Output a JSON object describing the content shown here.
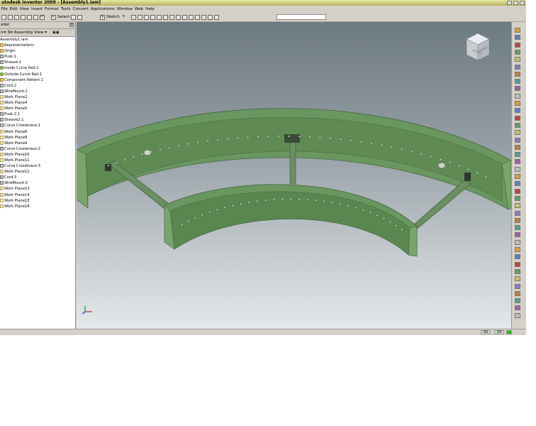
{
  "window": {
    "title": "utodesk Inventor 2009 - [Assembly1.iam]"
  },
  "menu": {
    "items": [
      "File",
      "Edit",
      "View",
      "Insert",
      "Format",
      "Tools",
      "Convert",
      "Applications",
      "Window",
      "Web",
      "Help"
    ]
  },
  "toolbar": {
    "select_label": "Select",
    "sketch_label": "Sketch"
  },
  "browser": {
    "header": "odel",
    "view_label": "Assembly View",
    "items": [
      {
        "label": "Assembly1.iam",
        "kind": "root"
      },
      {
        "label": "Representations",
        "kind": "folder"
      },
      {
        "label": "Origin",
        "kind": "folder"
      },
      {
        "label": "Pusk:1",
        "kind": "part"
      },
      {
        "label": "Sheave:1",
        "kind": "part"
      },
      {
        "label": "Inside Curve Rail:1",
        "kind": "cc"
      },
      {
        "label": "Outside Curve Rail:1",
        "kind": "cc"
      },
      {
        "label": "Component Pattern:1",
        "kind": "folder"
      },
      {
        "label": "Cord:2",
        "kind": "part"
      },
      {
        "label": "WireMount:2",
        "kind": "part"
      },
      {
        "label": "Work Plane2",
        "kind": "plane"
      },
      {
        "label": "Work Plane4",
        "kind": "plane"
      },
      {
        "label": "Work Plane5",
        "kind": "plane"
      },
      {
        "label": "Pusk:2:1",
        "kind": "part"
      },
      {
        "label": "Sheave2:1",
        "kind": "part"
      },
      {
        "label": "Curve Crossbrace:1",
        "kind": "part"
      },
      {
        "label": "Work Plane6",
        "kind": "plane"
      },
      {
        "label": "Work Plane8",
        "kind": "plane"
      },
      {
        "label": "Work Plane9",
        "kind": "plane"
      },
      {
        "label": "Curve Crossbrace:2",
        "kind": "part"
      },
      {
        "label": "Work Plane10",
        "kind": "plane"
      },
      {
        "label": "Work Plane11",
        "kind": "plane"
      },
      {
        "label": "Curve Crossbrace:3",
        "kind": "part"
      },
      {
        "label": "Work Plane12",
        "kind": "plane"
      },
      {
        "label": "Cord:3",
        "kind": "part"
      },
      {
        "label": "WireMount:3",
        "kind": "part"
      },
      {
        "label": "Work Plane13",
        "kind": "plane"
      },
      {
        "label": "Work Plane14",
        "kind": "plane"
      },
      {
        "label": "Work Plane15",
        "kind": "plane"
      },
      {
        "label": "Work Plane16",
        "kind": "plane"
      }
    ]
  },
  "viewcube": {
    "front_label": "FRONT",
    "right_label": "RIGHT"
  },
  "status": {
    "num1": "50",
    "num2": "24"
  },
  "colors": {
    "model_top": "#7fa870",
    "model_face": "#5f8a52",
    "accent_status": "#20c020"
  }
}
